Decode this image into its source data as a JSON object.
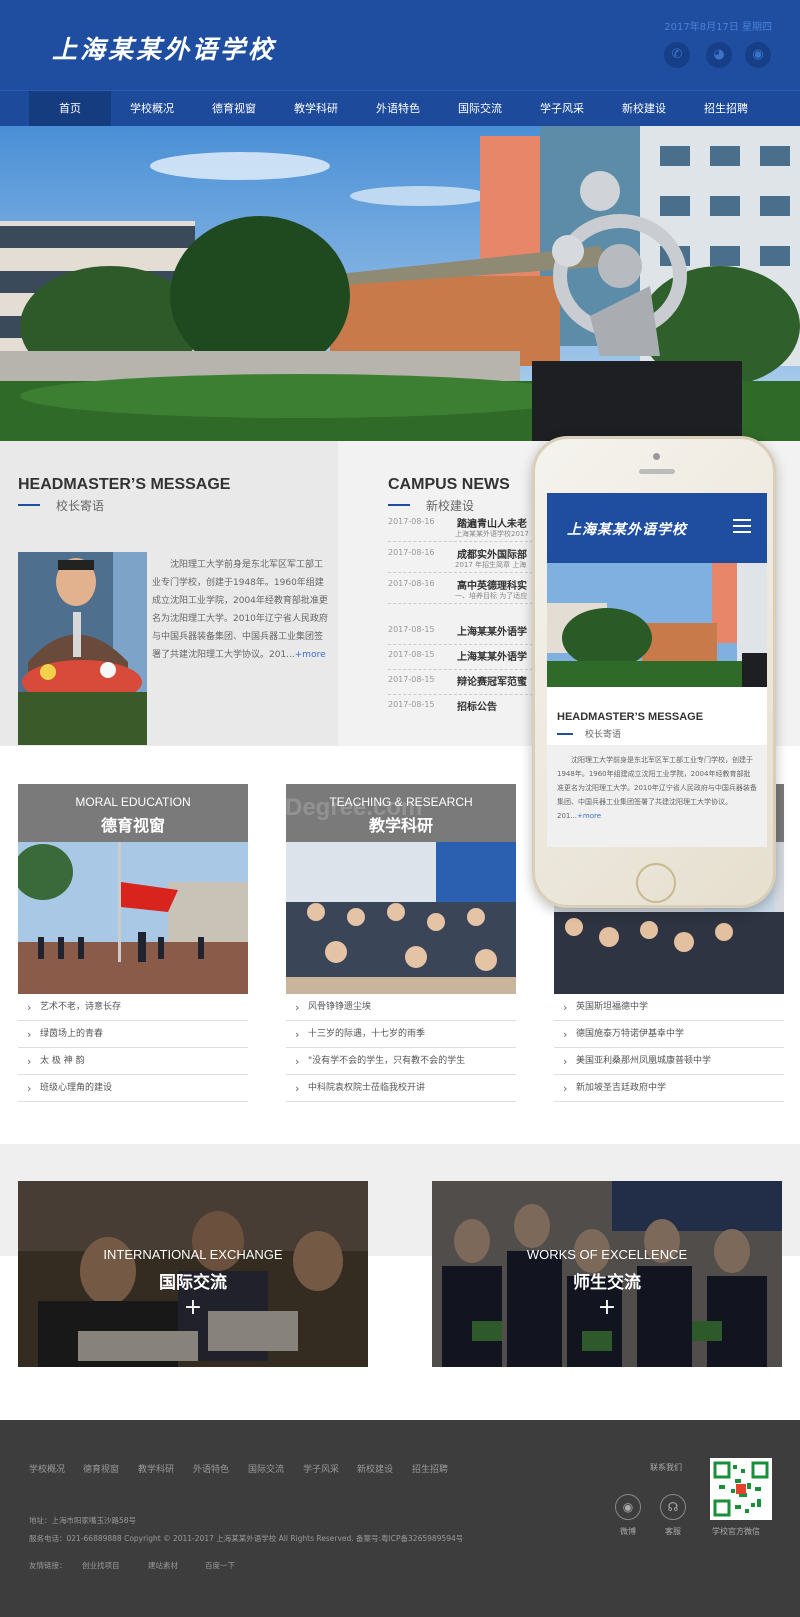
{
  "header": {
    "logo": "上海某某外语学校",
    "date": "2017年8月17日  星期四",
    "social_icons": [
      "phone-icon",
      "wechat-icon",
      "weibo-icon"
    ]
  },
  "nav": {
    "items": [
      "首页",
      "学校概况",
      "德育视窗",
      "教学科研",
      "外语特色",
      "国际交流",
      "学子风采",
      "新校建设",
      "招生招聘"
    ],
    "active_index": 0
  },
  "headmaster": {
    "title": "HEADMASTER’S MESSAGE",
    "subtitle": "校长寄语",
    "text": "沈阳理工大学前身是东北军区军工部工业专门学校，创建于1948年。1960年组建成立沈阳工业学院，2004年经教育部批准更名为沈阳理工大学。2010年辽宁省人民政府与中国兵器装备集团、中国兵器工业集团签署了共建沈阳理工大学协议。201...",
    "more": "+more"
  },
  "news": {
    "title": "CAMPUS NEWS",
    "subtitle": "新校建设",
    "items": [
      {
        "date": "2017-08-16",
        "title": "踏遍青山人未老",
        "sub": "上海某某外语学校2017"
      },
      {
        "date": "2017-08-16",
        "title": "成都实外国际部",
        "sub": "2017 年招生简章 上海"
      },
      {
        "date": "2017-08-16",
        "title": "高中英德理科实",
        "sub": "一、培养目标 为了适应"
      },
      {
        "date": "2017-08-15",
        "title": "上海某某外语学",
        "sub": ""
      },
      {
        "date": "2017-08-15",
        "title": "上海某某外语学",
        "sub": ""
      },
      {
        "date": "2017-08-15",
        "title": "辩论赛冠军范蜜",
        "sub": ""
      },
      {
        "date": "2017-08-15",
        "title": "招标公告",
        "sub": ""
      }
    ]
  },
  "phone": {
    "logo": "上海某某外语学校",
    "menu_icon": "hamburger-menu-icon",
    "title": "HEADMASTER’S MESSAGE",
    "subtitle": "校长寄语",
    "text": "沈阳理工大学前身是东北军区军工部工业专门学校，创建于1948年。1960年组建成立沈阳工业学院，2004年经教育部批准更名为沈阳理工大学。2010年辽宁省人民政府与中国兵器装备集团、中国兵器工业集团签署了共建沈阳理工大学协议。201...",
    "more": "+more"
  },
  "cards": [
    {
      "en": "MORAL EDUCATION",
      "zh": "德育视窗",
      "items": [
        "艺术不老，诗意长存",
        "绿茵场上的青春",
        "太 极 神 韵",
        "班级心理角的建设"
      ]
    },
    {
      "en": "TEACHING & RESEARCH",
      "zh": "教学科研",
      "items": [
        "风骨铮铮遗尘埃",
        "十三岁的际遇，十七岁的雨季",
        "\"没有学不会的学生，只有教不会的学生",
        "中科院袁权院士莅临我校开讲"
      ]
    },
    {
      "en": "",
      "zh": "",
      "items": [
        "英国斯坦福德中学",
        "德国施泰万特诺伊基幸中学",
        "美国亚利桑那州凤凰城康普顿中学",
        "新加坡圣吉廷政府中学"
      ]
    }
  ],
  "watermark": "Degree.com",
  "exchange": [
    {
      "en": "INTERNATIONAL EXCHANGE",
      "zh": "国际交流",
      "plus": "+"
    },
    {
      "en": "WORKS OF EXCELLENCE",
      "zh": "师生交流",
      "plus": "+"
    }
  ],
  "footer": {
    "links": [
      "学校概况",
      "德育视窗",
      "教学科研",
      "外语特色",
      "国际交流",
      "学子风采",
      "新校建设",
      "招生招聘"
    ],
    "address": "地址：上海市阳家嘴玉沙路58号",
    "contact": "服务电话：021-66889888 Copyright © 2011-2017 上海某某外语学校 All Rights Reserved.    备案号:粤ICP备3265989594号",
    "friend_label": "友情链接：",
    "friends": [
      "创业找项目",
      "建站素材",
      "百度一下"
    ],
    "contact_us": "联系我们",
    "weibo": "微博",
    "service": "客服",
    "wechat": "学校官方微信"
  }
}
